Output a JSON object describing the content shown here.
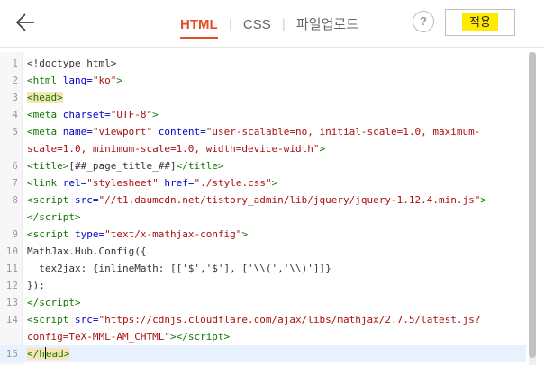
{
  "header": {
    "back_icon": "back-arrow-icon",
    "tabs": [
      {
        "label": "HTML",
        "active": true
      },
      {
        "label": "CSS",
        "active": false
      },
      {
        "label": "파일업로드",
        "active": false
      }
    ],
    "help_label": "?",
    "apply_label": "적용",
    "accent_color": "#e44d26",
    "apply_highlight_color": "#ffeb00"
  },
  "editor": {
    "current_line": 15,
    "line_numbers": [
      "1",
      "2",
      "3",
      "4",
      "5",
      "",
      "6",
      "7",
      "8",
      "",
      "9",
      "10",
      "11",
      "12",
      "13",
      "14",
      "",
      "15"
    ]
  }
}
